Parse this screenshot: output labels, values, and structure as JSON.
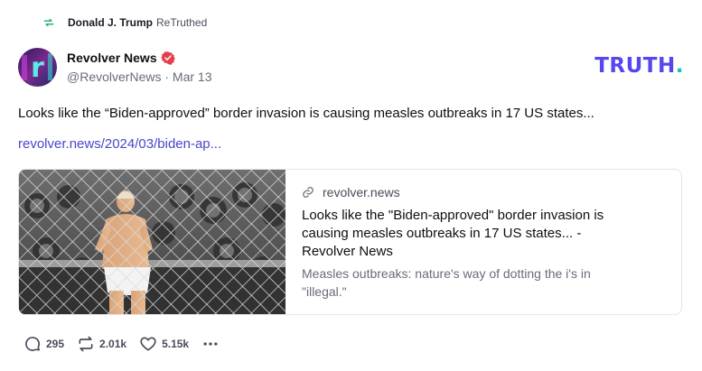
{
  "retruth": {
    "icon": "retruth-icon",
    "user": "Donald J. Trump",
    "label": "ReTruthed"
  },
  "author": {
    "name": "Revolver News",
    "handle_date": "@RevolverNews · Mar 13",
    "avatar_letter": "r",
    "verified_icon": "verified-badge-icon"
  },
  "brand": {
    "logo_text": "TRUTH",
    "logo_dot": ".",
    "color": "#5448ee",
    "dot_color": "#13c6b3"
  },
  "post": {
    "text": "Looks like the “Biden-approved” border invasion is causing measles outbreaks in 17 US states...",
    "link": "revolver.news/2024/03/biden-ap..."
  },
  "card": {
    "image": "fence-crowd-illustration",
    "link_icon": "link-icon",
    "domain": "revolver.news",
    "title": "Looks like the \"Biden-approved\" border invasion is causing measles outbreaks in 17 US states... - Revolver News",
    "description": "Measles outbreaks: nature's way of dotting the i's in \"illegal.\""
  },
  "actions": {
    "replies": "295",
    "retruths": "2.01k",
    "likes": "5.15k",
    "reply_icon": "reply-icon",
    "retruth_icon": "retruth-icon",
    "like_icon": "heart-icon",
    "more_icon": "more-dots-icon"
  }
}
